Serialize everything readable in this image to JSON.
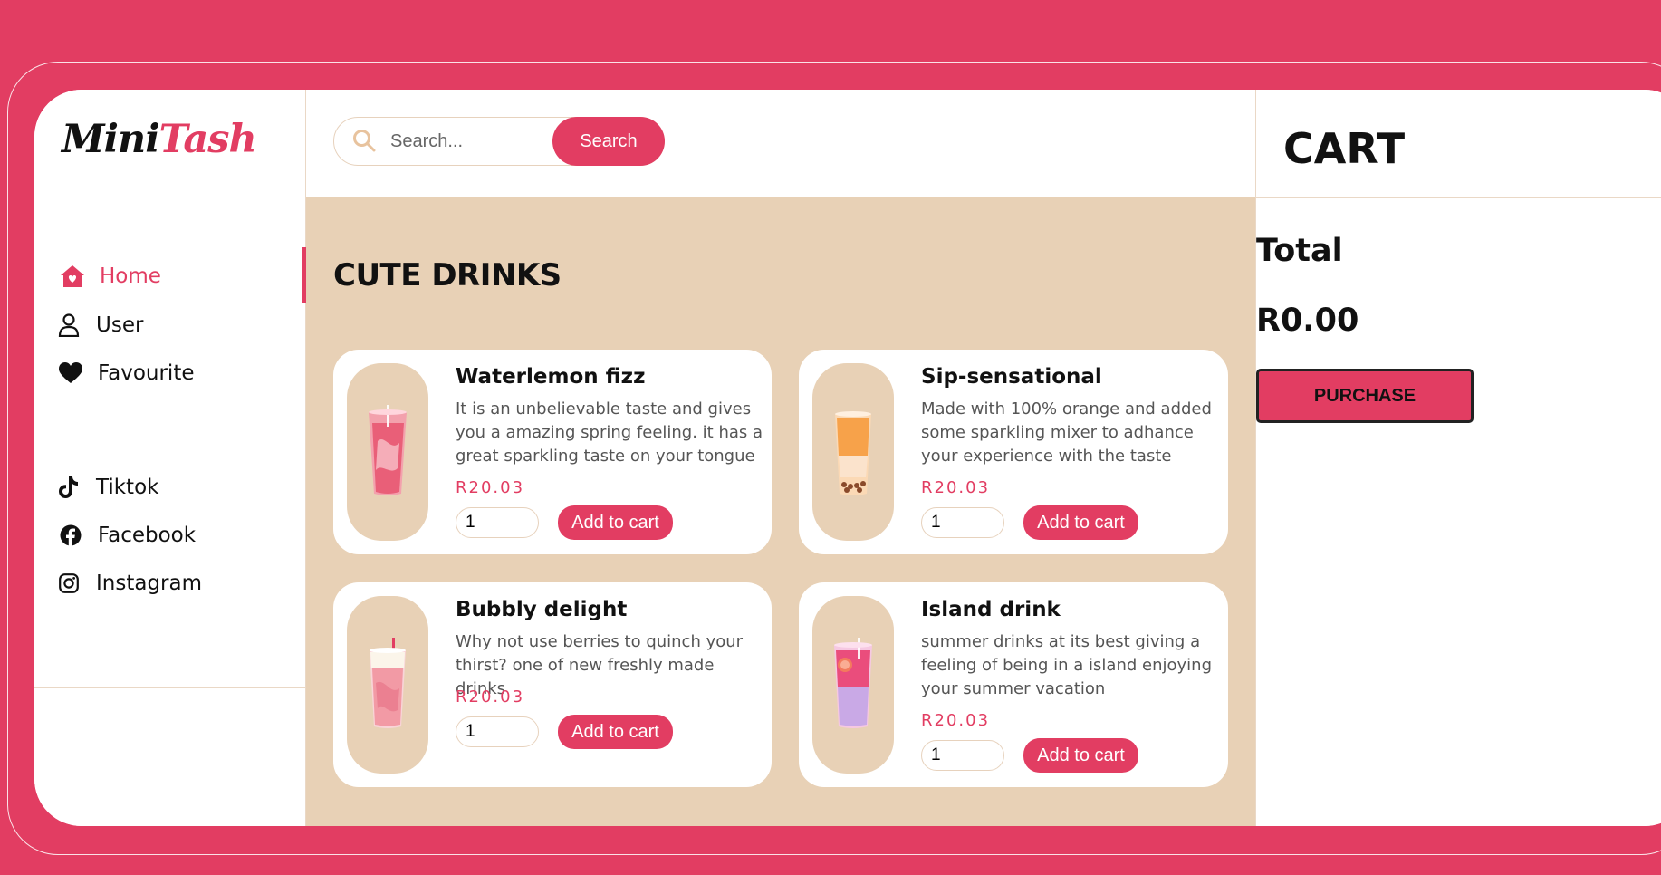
{
  "brand": {
    "part1": "Mini",
    "part2": "Tash"
  },
  "sidebar": {
    "nav": [
      {
        "label": "Home",
        "icon": "home-icon",
        "active": true
      },
      {
        "label": "User",
        "icon": "user-icon"
      },
      {
        "label": "Favourite",
        "icon": "heart-icon"
      }
    ],
    "social": [
      {
        "label": "Tiktok",
        "icon": "tiktok-icon"
      },
      {
        "label": "Facebook",
        "icon": "facebook-icon"
      },
      {
        "label": "Instagram",
        "icon": "instagram-icon"
      }
    ]
  },
  "search": {
    "placeholder": "Search...",
    "button_label": "Search"
  },
  "main": {
    "section_title": "CUTE DRINKS",
    "products": [
      {
        "name": "Waterlemon fizz",
        "description": "It is an unbelievable taste and gives you a amazing spring feeling. it has a great sparkling taste on your tongue",
        "price": "R20.03",
        "quantity": "1",
        "button_label": "Add to cart"
      },
      {
        "name": "Sip-sensational",
        "description": "Made with 100% orange and added some sparkling mixer to adhance your experience with the taste",
        "price": "R20.03",
        "quantity": "1",
        "button_label": "Add to cart"
      },
      {
        "name": "Bubbly delight",
        "description": "Why not use berries to quinch your thirst? one of new freshly made drinks",
        "price": "R20.03",
        "quantity": "1",
        "button_label": "Add to cart"
      },
      {
        "name": "Island drink",
        "description": "summer drinks at its best giving a feeling of being in a island enjoying your summer vacation",
        "price": "R20.03",
        "quantity": "1",
        "button_label": "Add to cart"
      }
    ]
  },
  "cart": {
    "title": "CART",
    "total_label": "Total",
    "total_value": "R0.00",
    "purchase_label": "PURCHASE"
  },
  "colors": {
    "accent": "#e23d62",
    "beige": "#e8d1b6",
    "text": "#111111"
  }
}
